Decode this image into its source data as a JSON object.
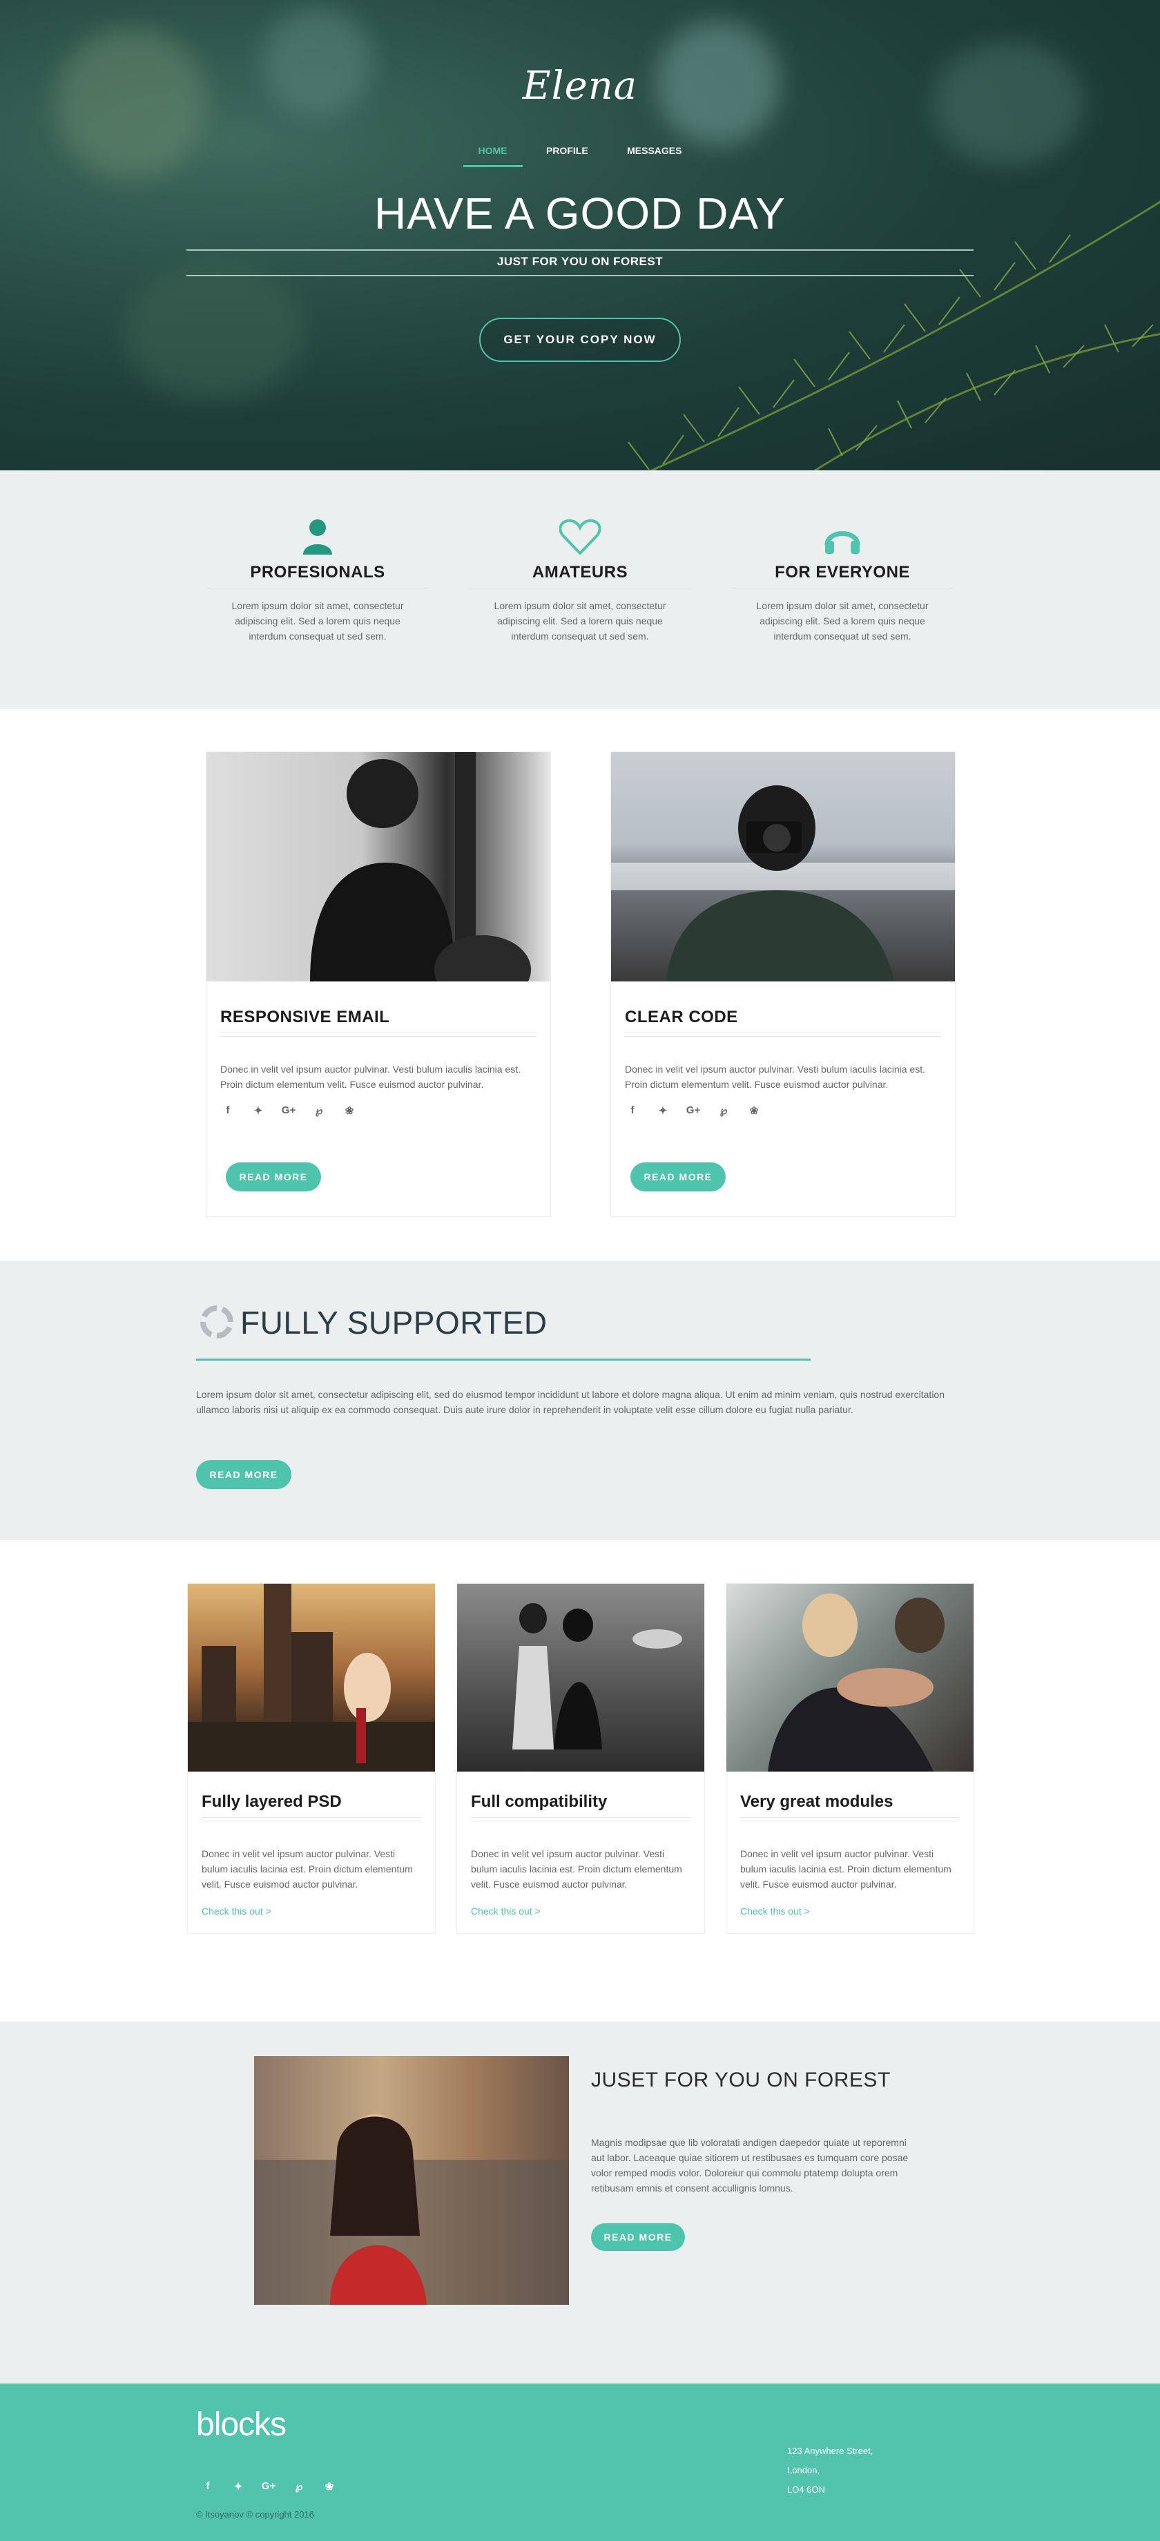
{
  "hero": {
    "logo": "Elena",
    "nav": [
      "HOME",
      "PROFILE",
      "MESSAGES"
    ],
    "title": "HAVE A GOOD DAY",
    "subtitle": "JUST FOR YOU ON FOREST",
    "cta": "GET YOUR COPY NOW"
  },
  "features": [
    {
      "icon": "user-icon",
      "title": "PROFESIONALS",
      "text": "Lorem ipsum dolor sit amet, consectetur adipiscing elit. Sed a lorem quis neque interdum consequat ut sed sem."
    },
    {
      "icon": "heart-icon",
      "title": "AMATEURS",
      "text": "Lorem ipsum dolor sit amet, consectetur adipiscing elit. Sed a lorem quis neque interdum consequat ut sed sem."
    },
    {
      "icon": "headphones-icon",
      "title": "FOR EVERYONE",
      "text": "Lorem ipsum dolor sit amet, consectetur adipiscing elit. Sed a lorem quis neque interdum consequat ut sed sem."
    }
  ],
  "cards2": [
    {
      "title": "RESPONSIVE EMAIL",
      "text": "Donec in velit vel ipsum auctor pulvinar. Vesti bulum iaculis lacinia est. Proin dictum elementum velit. Fusce euismod auctor pulvinar.",
      "button": "READ MORE"
    },
    {
      "title": "CLEAR CODE",
      "text": "Donec in velit vel ipsum auctor pulvinar. Vesti bulum iaculis lacinia est. Proin dictum elementum velit. Fusce euismod auctor pulvinar.",
      "button": "READ MORE"
    }
  ],
  "social_glyphs": [
    "f",
    "✦",
    "G+",
    "℘",
    "❀"
  ],
  "social_icons": [
    "facebook-icon",
    "twitter-icon",
    "google-plus-icon",
    "pinterest-icon",
    "dribbble-icon"
  ],
  "supported": {
    "title": "FULLY SUPPORTED",
    "text": "Lorem ipsum dolor sit amet, consectetur adipiscing elit, sed do eiusmod tempor incididunt ut labore et dolore magna aliqua. Ut enim ad minim veniam, quis nostrud exercitation ullamco laboris nisi ut aliquip ex ea commodo consequat. Duis aute irure dolor in reprehenderit in voluptate velit esse cillum dolore eu fugiat nulla pariatur.",
    "button": "READ MORE"
  },
  "cards3": [
    {
      "title": "Fully layered PSD",
      "text": "Donec in velit vel ipsum auctor pulvinar. Vesti bulum iaculis lacinia est. Proin dictum elementum velit. Fusce euismod auctor pulvinar.",
      "link": "Check this out >"
    },
    {
      "title": "Full compatibility",
      "text": "Donec in velit vel ipsum auctor pulvinar. Vesti bulum iaculis lacinia est. Proin dictum elementum velit. Fusce euismod auctor pulvinar.",
      "link": "Check this out >"
    },
    {
      "title": "Very great modules",
      "text": "Donec in velit vel ipsum auctor pulvinar. Vesti bulum iaculis lacinia est. Proin dictum elementum velit. Fusce euismod auctor pulvinar.",
      "link": "Check this out >"
    }
  ],
  "forest": {
    "title": "JUSET FOR YOU ON FOREST",
    "text": "Magnis modipsae que lib voloratati andigen daepedor quiate ut reporemni aut labor. Laceaque quiae sitiorem ut restibusaes es tumquam core posae volor remped modis volor. Doloreiur qui commolu ptatemp dolupta orem retibusam emnis et consent accullignis lomnus.",
    "button": "READ MORE"
  },
  "footer": {
    "brand": "blocks",
    "address": [
      "123 Anywhere Street,",
      "London,",
      "LO4 6ON"
    ],
    "copyright": "© Itsoyanov © copyright 2016"
  },
  "colors": {
    "accent": "#4fc4ac",
    "footer": "#52c4ad",
    "section_gray": "#eceff0"
  }
}
